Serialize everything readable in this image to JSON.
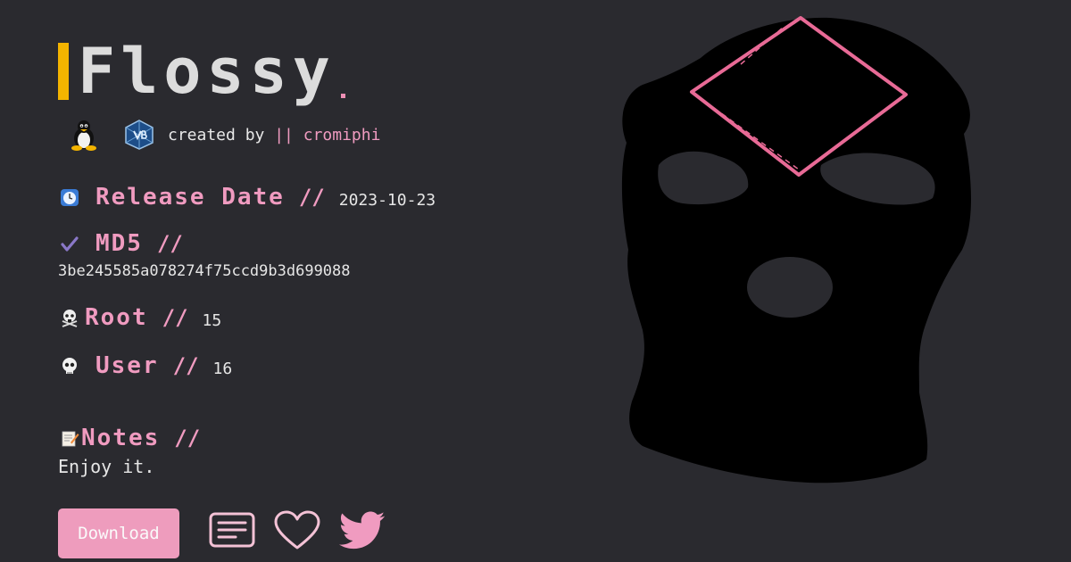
{
  "title": "Flossy",
  "created_by": {
    "prefix": "created by",
    "separator": "||",
    "author": "cromiphi"
  },
  "os_icons": [
    "linux-tux-icon",
    "virtualbox-icon"
  ],
  "fields": {
    "release_date": {
      "label": "Release Date",
      "slash": "//",
      "value": "2023-10-23",
      "icon": "clock-icon"
    },
    "md5": {
      "label": "MD5",
      "slash": "//",
      "value": "3be245585a078274f75ccd9b3d699088",
      "icon": "checkmark-icon"
    },
    "root": {
      "label": "Root",
      "slash": "//",
      "value": "15",
      "icon": "skull-crossbones-icon"
    },
    "user": {
      "label": "User",
      "slash": "//",
      "value": "16",
      "icon": "skull-icon"
    },
    "notes": {
      "label": "Notes",
      "slash": "//",
      "value": "Enjoy it.",
      "icon": "memo-icon"
    }
  },
  "actions": {
    "download_label": "Download",
    "icons": [
      "writeup-document-icon",
      "heart-icon",
      "twitter-icon"
    ]
  },
  "colors": {
    "accent_pink": "#f09bc0",
    "title_bar": "#f4b400",
    "background": "#2a2a2f"
  }
}
